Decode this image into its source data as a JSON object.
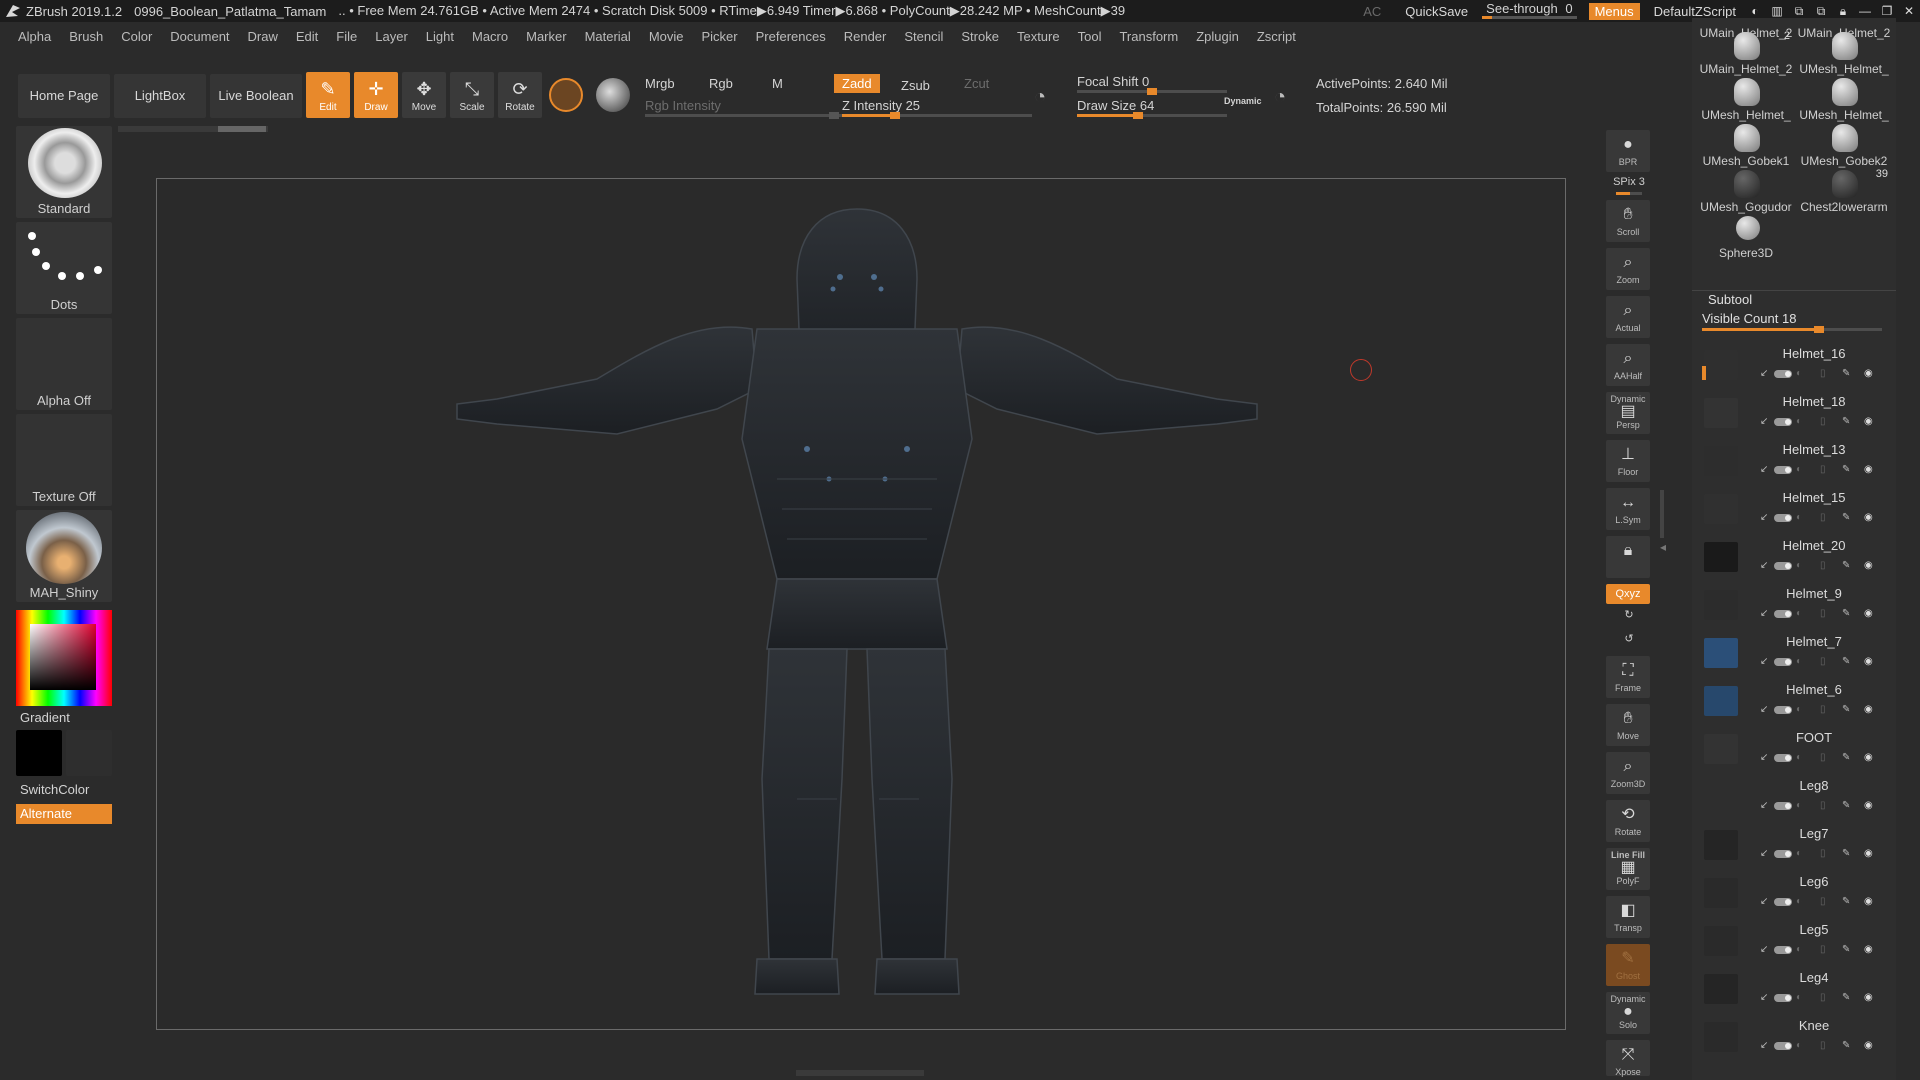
{
  "titlebar": {
    "app": "ZBrush 2019.1.2",
    "file": "0996_Boolean_Patlatma_Tamam",
    "stats": ".. • Free Mem 24.761GB • Active Mem 2474 • Scratch Disk 5009 • RTime▶6.949 Timer▶6.868 • PolyCount▶28.242 MP • MeshCount▶39",
    "ac": "AC",
    "quicksave": "QuickSave",
    "see_through_label": "See-through",
    "see_through_value": "0",
    "see_through_fraction": 0.0,
    "menus": "Menus",
    "script": "DefaultZScript"
  },
  "menu": [
    "Alpha",
    "Brush",
    "Color",
    "Document",
    "Draw",
    "Edit",
    "File",
    "Layer",
    "Light",
    "Macro",
    "Marker",
    "Material",
    "Movie",
    "Picker",
    "Preferences",
    "Render",
    "Stencil",
    "Stroke",
    "Texture",
    "Tool",
    "Transform",
    "Zplugin",
    "Zscript"
  ],
  "toolbar": {
    "home": "Home Page",
    "lightbox": "LightBox",
    "live_boolean": "Live Boolean",
    "edit": "Edit",
    "draw": "Draw",
    "move": "Move",
    "scale": "Scale",
    "rotate": "Rotate",
    "mrgb": "Mrgb",
    "rgb": "Rgb",
    "m": "M",
    "rgb_intensity": "Rgb Intensity",
    "zadd": "Zadd",
    "zsub": "Zsub",
    "zcut": "Zcut",
    "z_intensity": "Z Intensity 25",
    "z_intensity_value": 25,
    "focal_shift": "Focal Shift 0",
    "focal_shift_value": 0,
    "draw_size": "Draw Size 64",
    "draw_size_value": 64,
    "dynamic": "Dynamic",
    "active_points": "ActivePoints: 2.640 Mil",
    "total_points": "TotalPoints: 26.590 Mil"
  },
  "left": {
    "brush": "Standard",
    "stroke": "Dots",
    "alpha": "Alpha Off",
    "texture": "Texture Off",
    "material": "MAH_Shiny",
    "gradient": "Gradient",
    "switchcolor": "SwitchColor",
    "alternate": "Alternate"
  },
  "rightshelf": {
    "bpr": "BPR",
    "spix": "SPix 3",
    "spix_value": 3,
    "scroll": "Scroll",
    "zoom": "Zoom",
    "actual": "Actual",
    "aahalf": "AAHalf",
    "dynamic_label": "Dynamic",
    "persp": "Persp",
    "floor": "Floor",
    "lsym": "L.Sym",
    "xyz": "Qxyz",
    "frame": "Frame",
    "move": "Move",
    "zoom3d": "Zoom3D",
    "rotate": "Rotate",
    "linefill": "Line Fill",
    "polyf": "PolyF",
    "transp": "Transp",
    "ghost": "Ghost",
    "dynamic2": "Dynamic",
    "solo": "Solo",
    "xpose": "Xpose"
  },
  "toolpanel": {
    "thumbs": [
      {
        "label": "UMain_Helmet_2",
        "count": ""
      },
      {
        "label": "UMain_Helmet_2",
        "count": ""
      },
      {
        "label": "UMain_Helmet_2",
        "count": "2"
      },
      {
        "label": "UMesh_Helmet_",
        "count": ""
      },
      {
        "label": "UMesh_Helmet_",
        "count": ""
      },
      {
        "label": "UMesh_Helmet_",
        "count": ""
      },
      {
        "label": "UMesh_Gobek1",
        "count": ""
      },
      {
        "label": "UMesh_Gobek2",
        "count": ""
      },
      {
        "label": "UMesh_Gogudor",
        "count": ""
      },
      {
        "label": "Chest2lowerarm",
        "count": "39"
      },
      {
        "label": "Sphere3D",
        "count": ""
      }
    ],
    "subtool_title": "Subtool",
    "visible_count": "Visible Count 18",
    "visible_count_fraction": 0.65,
    "subtools": [
      "Helmet_16",
      "Helmet_18",
      "Helmet_13",
      "Helmet_15",
      "Helmet_20",
      "Helmet_9",
      "Helmet_7",
      "Helmet_6",
      "FOOT",
      "Leg8",
      "Leg7",
      "Leg6",
      "Leg5",
      "Leg4",
      "Knee"
    ]
  },
  "colors": {
    "accent": "#e8892b",
    "bg": "#2b2b2b",
    "panel": "#353535"
  }
}
